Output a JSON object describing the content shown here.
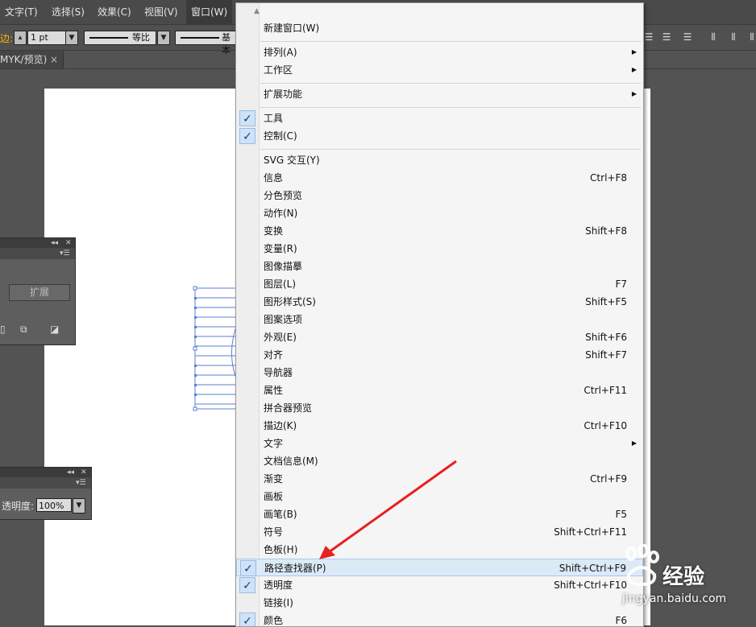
{
  "menubar": {
    "items": [
      {
        "label": "文字(T)"
      },
      {
        "label": "选择(S)"
      },
      {
        "label": "效果(C)"
      },
      {
        "label": "视图(V)"
      },
      {
        "label": "窗口(W)"
      }
    ]
  },
  "toolbar": {
    "stroke_label": "边:",
    "stroke_weight": "1 pt",
    "profile_label": "等比",
    "brush_label": "基本"
  },
  "document_tab": {
    "title": "MYK/预览)",
    "close": "×"
  },
  "pathfinder_panel": {
    "expand_label": "扩展"
  },
  "transparency_panel": {
    "opacity_label": "透明度:",
    "opacity_value": "100%"
  },
  "window_menu": {
    "items": [
      {
        "label": "新建窗口(W)"
      },
      {
        "label": "排列(A)",
        "submenu": true
      },
      {
        "label": "工作区",
        "submenu": true
      },
      {
        "label": "扩展功能",
        "submenu": true
      },
      {
        "label": "工具",
        "checked": true
      },
      {
        "label": "控制(C)",
        "checked": true
      },
      {
        "label": "SVG 交互(Y)"
      },
      {
        "label": "信息",
        "shortcut": "Ctrl+F8"
      },
      {
        "label": "分色预览"
      },
      {
        "label": "动作(N)"
      },
      {
        "label": "变换",
        "shortcut": "Shift+F8"
      },
      {
        "label": "变量(R)"
      },
      {
        "label": "图像描摹"
      },
      {
        "label": "图层(L)",
        "shortcut": "F7"
      },
      {
        "label": "图形样式(S)",
        "shortcut": "Shift+F5"
      },
      {
        "label": "图案选项"
      },
      {
        "label": "外观(E)",
        "shortcut": "Shift+F6"
      },
      {
        "label": "对齐",
        "shortcut": "Shift+F7"
      },
      {
        "label": "导航器"
      },
      {
        "label": "属性",
        "shortcut": "Ctrl+F11"
      },
      {
        "label": "拼合器预览"
      },
      {
        "label": "描边(K)",
        "shortcut": "Ctrl+F10"
      },
      {
        "label": "文字",
        "submenu": true
      },
      {
        "label": "文档信息(M)"
      },
      {
        "label": "渐变",
        "shortcut": "Ctrl+F9"
      },
      {
        "label": "画板"
      },
      {
        "label": "画笔(B)",
        "shortcut": "F5"
      },
      {
        "label": "符号",
        "shortcut": "Shift+Ctrl+F11"
      },
      {
        "label": "色板(H)"
      },
      {
        "label": "路径查找器(P)",
        "shortcut": "Shift+Ctrl+F9",
        "checked": true,
        "highlighted": true
      },
      {
        "label": "透明度",
        "shortcut": "Shift+Ctrl+F10",
        "checked": true
      },
      {
        "label": "链接(I)"
      },
      {
        "label": "颜色",
        "shortcut": "F6",
        "checked": true
      }
    ]
  },
  "watermark": {
    "brand": "经验",
    "url": "jingyan.baidu.com"
  },
  "colors": {
    "accent_arrow": "#e8201f",
    "check_bg": "#cfe3f7",
    "highlight": "#dceaf8"
  }
}
